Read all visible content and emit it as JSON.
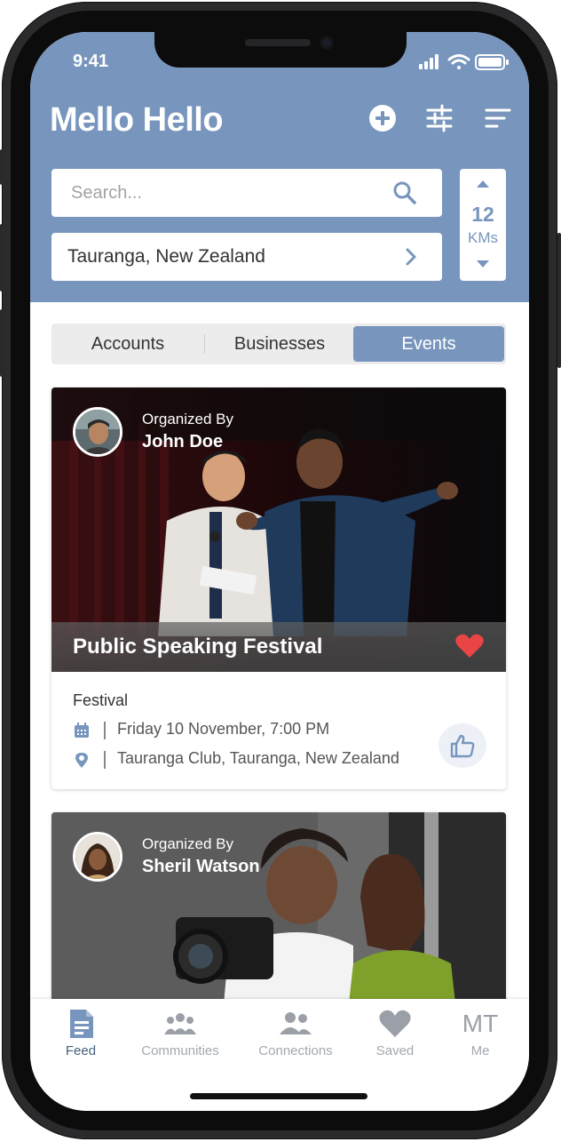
{
  "status": {
    "time": "9:41"
  },
  "app": {
    "logo": "Mello Hello"
  },
  "header_icons": [
    "add-circle-icon",
    "filter-sliders-icon",
    "sort-lines-icon"
  ],
  "search": {
    "placeholder": "Search..."
  },
  "location": {
    "value": "Tauranga, New Zealand"
  },
  "distance": {
    "value": "12",
    "unit": "KMs"
  },
  "tabs": [
    {
      "label": "Accounts",
      "active": false
    },
    {
      "label": "Businesses",
      "active": false
    },
    {
      "label": "Events",
      "active": true
    }
  ],
  "events": [
    {
      "organized_by_label": "Organized By",
      "organizer": "John Doe",
      "title": "Public Speaking Festival",
      "favorited": true,
      "category": "Festival",
      "datetime": "Friday 10 November, 7:00 PM",
      "venue": "Tauranga Club, Tauranga, New Zealand"
    },
    {
      "organized_by_label": "Organized By",
      "organizer": "Sheril Watson"
    }
  ],
  "bottom_nav": [
    {
      "label": "Feed",
      "icon": "feed-document-icon",
      "active": true
    },
    {
      "label": "Communities",
      "icon": "communities-icon",
      "active": false
    },
    {
      "label": "Connections",
      "icon": "connections-icon",
      "active": false
    },
    {
      "label": "Saved",
      "icon": "heart-icon",
      "active": false
    },
    {
      "label": "Me",
      "initials": "MT",
      "active": false
    }
  ],
  "colors": {
    "brand": "#7896bd",
    "nav_active": "#45607f",
    "favorite": "#e94545"
  }
}
